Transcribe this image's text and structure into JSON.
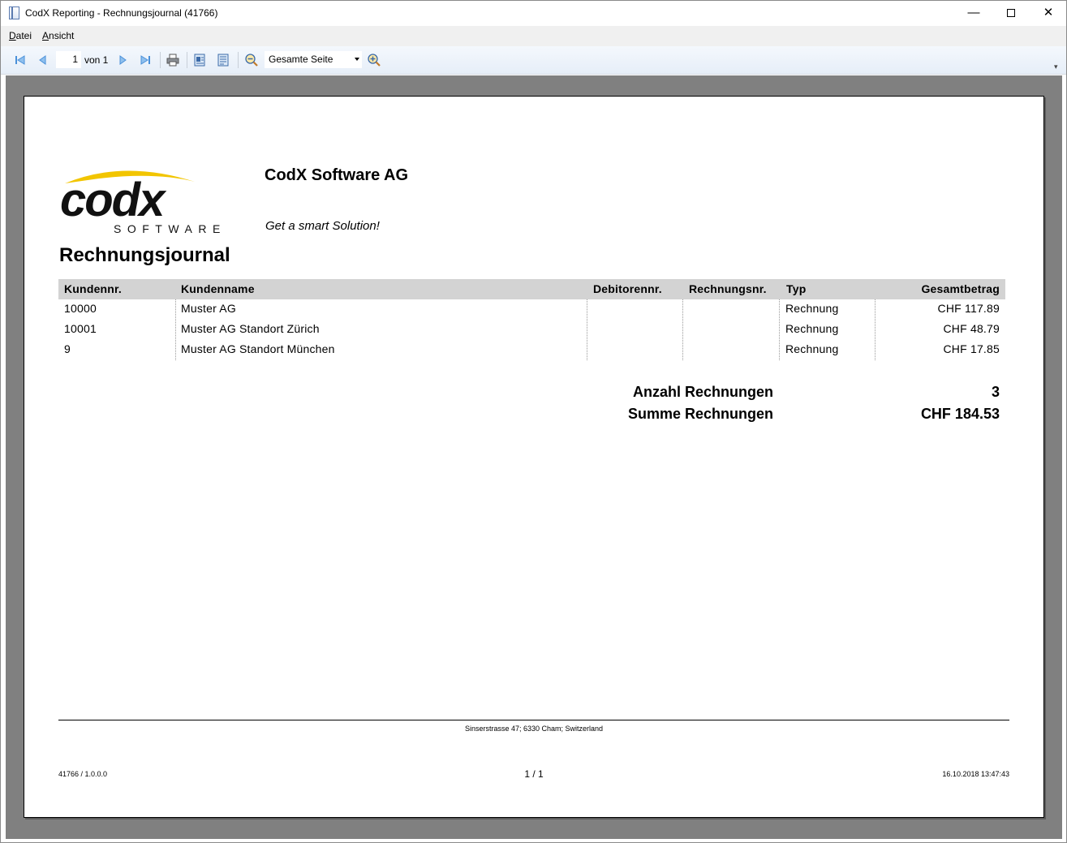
{
  "window": {
    "title": "CodX Reporting - Rechnungsjournal (41766)",
    "minimize_glyph": "—",
    "close_glyph": "✕"
  },
  "menu": {
    "datei_key": "D",
    "datei_rest": "atei",
    "ansicht_key": "A",
    "ansicht_rest": "nsicht"
  },
  "toolbar": {
    "page_number": "1",
    "page_of": "von 1",
    "zoom_value": "Gesamte Seite",
    "icons": [
      "first-page-icon",
      "previous-page-icon",
      "next-page-icon",
      "last-page-icon",
      "print-icon",
      "export-icon",
      "page-setup-icon",
      "zoom-out-icon",
      "zoom-in-icon"
    ]
  },
  "report": {
    "logo": {
      "word": "codx",
      "subword": "SOFTWARE",
      "accent_color": "#f2c500"
    },
    "company_name": "CodX Software AG",
    "slogan": "Get a smart Solution!",
    "title": "Rechnungsjournal",
    "table": {
      "headers": {
        "kundennr": "Kundennr.",
        "kundenname": "Kundenname",
        "debitorennr": "Debitorennr.",
        "rechnungsnr": "Rechnungsnr.",
        "typ": "Typ",
        "gesamtbetrag": "Gesamtbetrag"
      },
      "rows": [
        {
          "kundennr": "10000",
          "kundenname": "Muster AG",
          "debitorennr": "",
          "rechnungsnr": "",
          "typ": "Rechnung",
          "gesamtbetrag": "CHF 117.89"
        },
        {
          "kundennr": "10001",
          "kundenname": "Muster AG Standort Zürich",
          "debitorennr": "",
          "rechnungsnr": "",
          "typ": "Rechnung",
          "gesamtbetrag": "CHF 48.79"
        },
        {
          "kundennr": "9",
          "kundenname": "Muster AG Standort München",
          "debitorennr": "",
          "rechnungsnr": "",
          "typ": "Rechnung",
          "gesamtbetrag": "CHF 17.85"
        }
      ]
    },
    "summary": {
      "count_label": "Anzahl Rechnungen",
      "count_value": "3",
      "sum_label": "Summe Rechnungen",
      "sum_value": "CHF 184.53"
    },
    "footer": {
      "address": "Sinserstrasse 47; 6330 Cham; Switzerland",
      "version": "41766 / 1.0.0.0",
      "pages": "1 / 1",
      "datetime": "16.10.2018 13:47:43"
    }
  },
  "colors": {
    "preview_background": "#808080",
    "table_header_background": "#d3d3d3",
    "toolbar_icon_blue": "#4a90d9"
  }
}
